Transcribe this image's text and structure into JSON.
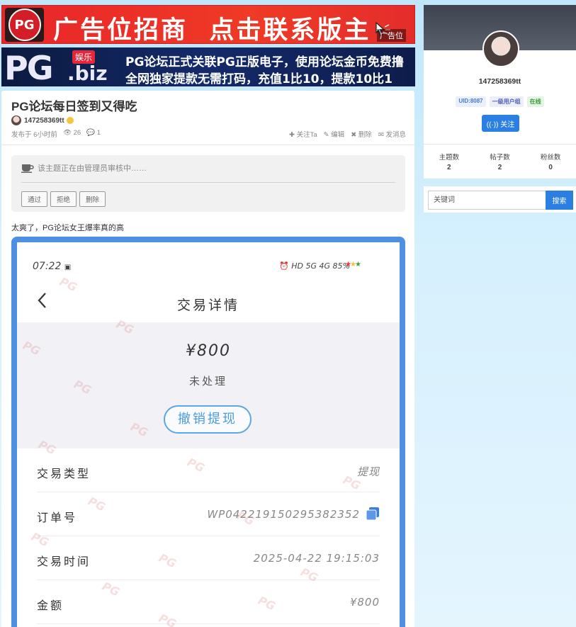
{
  "ads": {
    "banner1": {
      "logo": "PG",
      "text": "广告位招商  点击联系版主",
      "tag": "广告位"
    },
    "banner2": {
      "pg": "PG",
      "yule": "娱乐",
      "biz": ".biz",
      "line1": "PG论坛正式关联PG正版电子，使用论坛金币免费撸",
      "line2": "全网独家提款无需打码，充值1比10，提款10比1"
    }
  },
  "thread": {
    "title": "PG论坛每日签到又得吃",
    "author": "147258369tt",
    "posted": "发布于 6小时前",
    "views": "26",
    "replies": "1",
    "actions": {
      "follow": "关注Ta",
      "edit": "编辑",
      "delete": "删除",
      "message": "发消息"
    },
    "review": {
      "message": "该主题正在由管理员审核中……",
      "approve": "通过",
      "reject": "拒绝",
      "remove": "删除"
    },
    "body_text": "太爽了，PG论坛女王爆率真的高",
    "screenshot": {
      "time": "07:22",
      "status_right": "HD 5G 4G 85%",
      "page_title": "交易详情",
      "amount": "¥800",
      "status": "未处理",
      "cancel_button": "撤销提现",
      "rows": [
        {
          "label": "交易类型",
          "value": "提现"
        },
        {
          "label": "订单号",
          "value": "WP042219150295382352"
        },
        {
          "label": "交易时间",
          "value": "2025-04-22 19:15:03"
        },
        {
          "label": "金额",
          "value": "¥800"
        }
      ],
      "watermark": "PG"
    }
  },
  "sidebar": {
    "username": "147258369tt",
    "uid": "UID:8087",
    "group": "一级用户组",
    "online": "在线",
    "follow_button": "关注",
    "stats": [
      {
        "label": "主题数",
        "value": "2"
      },
      {
        "label": "帖子数",
        "value": "2"
      },
      {
        "label": "粉丝数",
        "value": "0"
      }
    ],
    "search": {
      "placeholder": "关键词",
      "button": "搜索"
    }
  },
  "colors": {
    "accent": "#2b7fe3",
    "frame": "#4d8fe0",
    "ad_red": "#e8262a",
    "ad_navy": "#142a6b"
  }
}
